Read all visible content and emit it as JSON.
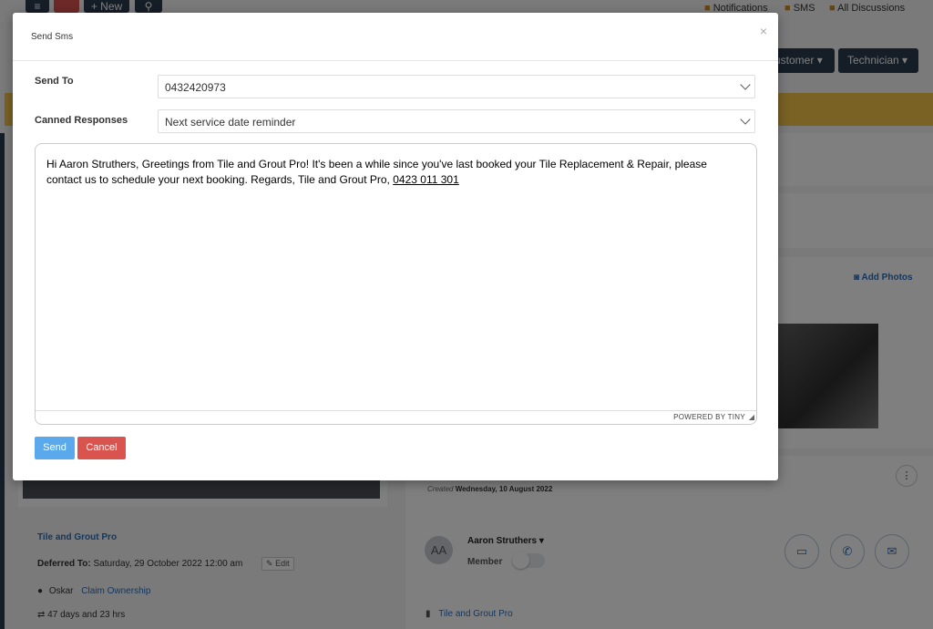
{
  "topbar": {
    "new_label": "New",
    "notifications": "Notifications",
    "sms": "SMS",
    "discussions": "All Discussions"
  },
  "header": {
    "customer_dropdown": "ustomer",
    "technician_dropdown": "Technician"
  },
  "photos": {
    "add_photos": "Add Photos"
  },
  "job": {
    "company": "Tile and Grout Pro",
    "deferred_label": "Deferred To:",
    "deferred_value": "Saturday, 29 October 2022 12:00 am",
    "edit": "Edit",
    "owner": "Oskar",
    "claim": "Claim Ownership",
    "duration": "47 days and 23 hrs"
  },
  "activity": {
    "created_label": "Created",
    "created_value": "Wednesday, 10 August 2022",
    "avatar_initials": "AA",
    "name": "Aaron Struthers",
    "role": "Member",
    "company": "Tile and Grout Pro"
  },
  "modal": {
    "title": "Send Sms",
    "close": "×",
    "send_to_label": "Send To",
    "send_to_value": "0432420973",
    "canned_label": "Canned Responses",
    "canned_value": "Next service date reminder",
    "message": "Hi Aaron Struthers, Greetings from Tile and Grout Pro! It's been a while since you've last booked your Tile Replacement & Repair, please contact us to schedule your next booking. Regards, Tile and Grout Pro,",
    "message_phone": "0423 011 301",
    "powered_by": "POWERED BY TINY",
    "send_button": "Send",
    "cancel_button": "Cancel"
  },
  "colors": {
    "send": "#5aa9ec",
    "cancel": "#d9534f",
    "navy": "#2b3a4e",
    "alert_bar": "#f4c54a"
  }
}
